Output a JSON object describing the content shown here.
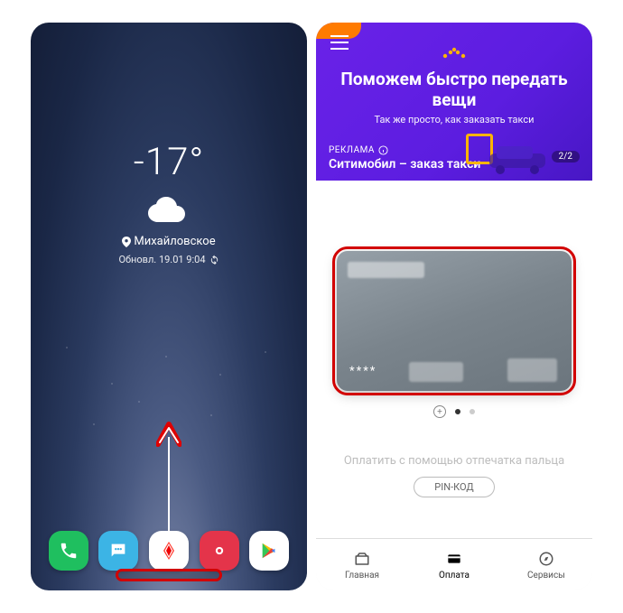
{
  "left": {
    "temperature": "-17°",
    "location": "Михайловское",
    "updated": "Обновл. 19.01 9:04"
  },
  "right": {
    "banner": {
      "title": "Поможем быстро передать вещи",
      "subtitle": "Так же просто, как заказать такси",
      "ad_tag": "РЕКЛАМА",
      "ad_source": "Ситимобил – заказ такси",
      "page_indicator": "2/2"
    },
    "card": {
      "masked_digits": "****"
    },
    "fingerprint_prompt": "Оплатить с помощью отпечатка пальца",
    "pin_button": "PIN-КОД",
    "nav": {
      "home": "Главная",
      "pay": "Оплата",
      "services": "Сервисы"
    }
  }
}
